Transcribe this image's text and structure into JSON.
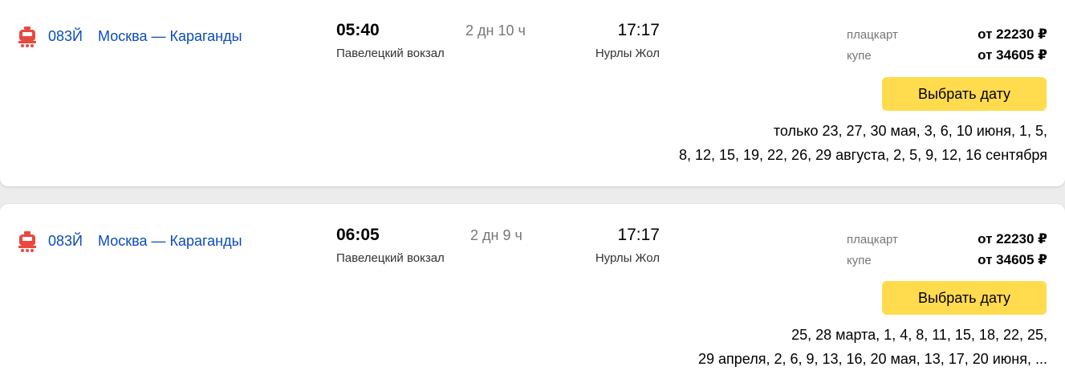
{
  "results": [
    {
      "train_number": "083Й",
      "route": "Москва — Караганды",
      "departure_time": "05:40",
      "departure_station": "Павелецкий вокзал",
      "duration": "2 дн 10 ч",
      "arrival_time": "17:17",
      "arrival_station": "Нурлы Жол",
      "classes": [
        {
          "label": "плацкарт",
          "price": "от 22230 ₽"
        },
        {
          "label": "купе",
          "price": "от 34605 ₽"
        }
      ],
      "button_label": "Выбрать дату",
      "dates_line1": "только 23, 27, 30 мая, 3, 6, 10 июня, 1, 5,",
      "dates_line2": "8, 12, 15, 19, 22, 26, 29 августа, 2, 5, 9, 12, 16 сентября"
    },
    {
      "train_number": "083Й",
      "route": "Москва — Караганды",
      "departure_time": "06:05",
      "departure_station": "Павелецкий вокзал",
      "duration": "2 дн 9 ч",
      "arrival_time": "17:17",
      "arrival_station": "Нурлы Жол",
      "classes": [
        {
          "label": "плацкарт",
          "price": "от 22230 ₽"
        },
        {
          "label": "купе",
          "price": "от 34605 ₽"
        }
      ],
      "button_label": "Выбрать дату",
      "dates_line1": "25, 28 марта, 1, 4, 8, 11, 15, 18, 22, 25,",
      "dates_line2": "29 апреля, 2, 6, 9, 13, 16, 20 мая, 13, 17, 20 июня, ..."
    }
  ],
  "icons": {
    "train": "train-icon"
  },
  "colors": {
    "link": "#0b4bbd",
    "button": "#ffdb4d",
    "train_icon": "#e8493f",
    "muted": "#777777"
  }
}
